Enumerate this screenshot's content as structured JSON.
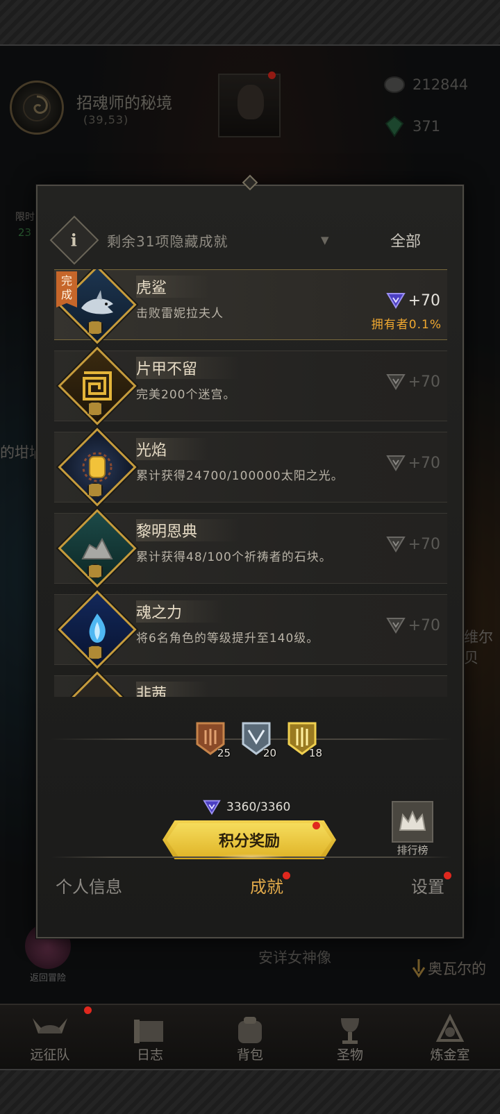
{
  "location": {
    "name": "招魂师的秘境",
    "coords": "(39,53)"
  },
  "resources": {
    "coins": "212844",
    "gems": "371"
  },
  "background": {
    "left_label": "的坩埚",
    "right_label": "维尔贝",
    "place_label": "安详女神像",
    "quest_hint": "奥瓦尔的",
    "return_label": "返回冒险",
    "limited_label": "限时",
    "limited_count": "23"
  },
  "filter": {
    "info": "i",
    "text": "剩余31项隐藏成就",
    "all_label": "全部"
  },
  "achievements": [
    {
      "title": "虎鲨",
      "desc": "击败雷妮拉夫人",
      "reward": "+70",
      "done": true,
      "done_tag": "完成",
      "owner": "拥有者0.1%"
    },
    {
      "title": "片甲不留",
      "desc": "完美200个迷宫。",
      "reward": "+70"
    },
    {
      "title": "光焰",
      "desc": "累计获得24700/100000太阳之光。",
      "reward": "+70"
    },
    {
      "title": "黎明恩典",
      "desc": "累计获得48/100个祈祷者的石块。",
      "reward": "+70"
    },
    {
      "title": "魂之力",
      "desc": "将6名角色的等级提升至140级。",
      "reward": "+70"
    },
    {
      "title": "非茜",
      "desc": "",
      "reward": ""
    }
  ],
  "medals": [
    {
      "count": "25"
    },
    {
      "count": "20"
    },
    {
      "count": "18"
    }
  ],
  "points": "3360/3360",
  "reward_button": "积分奖励",
  "rank_label": "排行榜",
  "tabs": [
    {
      "label": "个人信息"
    },
    {
      "label": "成就"
    },
    {
      "label": "设置"
    }
  ],
  "nav": [
    {
      "label": "远征队"
    },
    {
      "label": "日志"
    },
    {
      "label": "背包"
    },
    {
      "label": "圣物"
    },
    {
      "label": "炼金室"
    }
  ],
  "colors": {
    "accent_gold": "#e0a94a",
    "owner_orange": "#f0a830",
    "done_tag": "#c6662a",
    "notification_red": "#e0281e"
  }
}
